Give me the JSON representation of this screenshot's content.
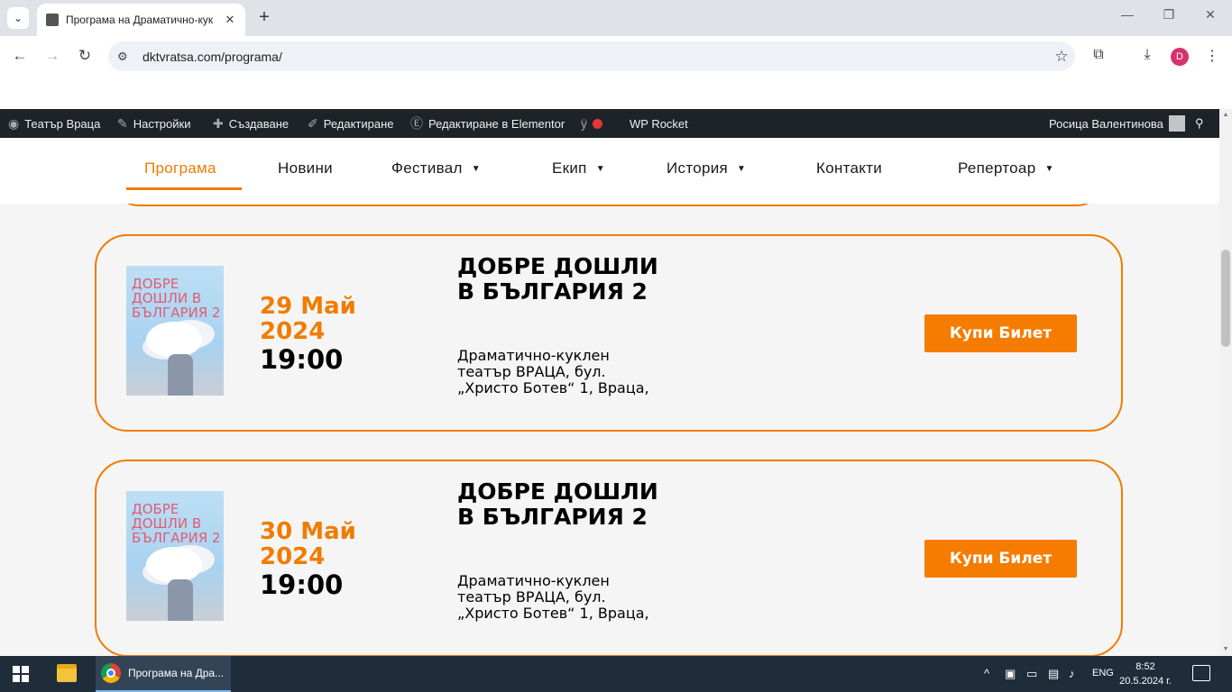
{
  "browser": {
    "tab_title": "Програма на Драматично-кук",
    "url": "dktvratsa.com/programa/",
    "profile_initial": "D"
  },
  "wp_admin_bar": {
    "site": "Театър Враца",
    "settings": "Настройки",
    "create": "Създаване",
    "edit": "Редактиране",
    "edit_elementor": "Редактиране в Elementor",
    "wp_rocket": "WP Rocket",
    "user": "Росица Валентинова"
  },
  "main_nav": [
    {
      "label": "Програма",
      "active": true
    },
    {
      "label": "Новини"
    },
    {
      "label": "Фестивал",
      "dropdown": true
    },
    {
      "label": "Екип",
      "dropdown": true
    },
    {
      "label": "История",
      "dropdown": true
    },
    {
      "label": "Контакти"
    },
    {
      "label": "Репертоар",
      "dropdown": true
    }
  ],
  "events": [
    {
      "poster_title": "ДОБРЕ ДОШЛИ В БЪЛГАРИЯ 2",
      "date": "29 Май 2024",
      "time": "19:00",
      "title": "ДОБРЕ ДОШЛИ В БЪЛГАРИЯ 2",
      "venue": "Драматично-куклен театър ВРАЦА, бул. „Христо Ботев“ 1, Враца,",
      "button": "Купи Билет"
    },
    {
      "poster_title": "ДОБРЕ ДОШЛИ В БЪЛГАРИЯ 2",
      "date": "30 Май 2024",
      "time": "19:00",
      "title": "ДОБРЕ ДОШЛИ В БЪЛГАРИЯ 2",
      "venue": "Драматично-куклен театър ВРАЦА, бул. „Христо Ботев“ 1, Враца,",
      "button": "Купи Билет"
    }
  ],
  "taskbar": {
    "chrome_task_label": "Програма на Дра...",
    "language": "ENG",
    "time": "8:52",
    "date": "20.5.2024 г."
  },
  "colors": {
    "accent": "#f07c00",
    "wp_bar": "#1d2327",
    "taskbar": "#1f2d3a"
  }
}
